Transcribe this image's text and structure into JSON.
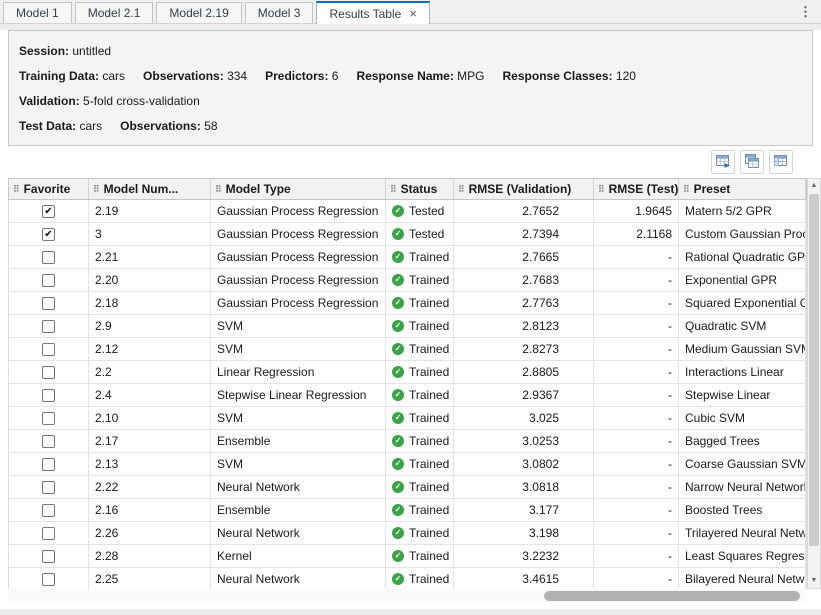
{
  "colors": {
    "accent_blue": "#0072bd",
    "status_green": "#3aa345"
  },
  "icons": {
    "overflow_menu": "⋮",
    "close": "×",
    "grip": "⠿",
    "checkbox_check": "✔",
    "status_check": "✓",
    "scroll_up": "▲",
    "scroll_down": "▼"
  },
  "tab_bar": {
    "tabs": [
      {
        "label": "Model 1",
        "active": false,
        "closable": false
      },
      {
        "label": "Model 2.1",
        "active": false,
        "closable": false
      },
      {
        "label": "Model 2.19",
        "active": false,
        "closable": false
      },
      {
        "label": "Model 3",
        "active": false,
        "closable": false
      },
      {
        "label": "Results Table",
        "active": true,
        "closable": true
      }
    ]
  },
  "session_panel": {
    "lines": [
      {
        "pairs": [
          {
            "label": "Session:",
            "value": "untitled"
          }
        ]
      },
      {
        "pairs": [
          {
            "label": "Training Data:",
            "value": "cars"
          },
          {
            "label": "Observations:",
            "value": "334"
          },
          {
            "label": "Predictors:",
            "value": "6"
          },
          {
            "label": "Response Name:",
            "value": "MPG"
          },
          {
            "label": "Response Classes:",
            "value": "120"
          }
        ]
      },
      {
        "pairs": [
          {
            "label": "Validation:",
            "value": "5-fold cross-validation"
          }
        ]
      },
      {
        "pairs": [
          {
            "label": "Test Data:",
            "value": "cars"
          },
          {
            "label": "Observations:",
            "value": "58"
          }
        ]
      }
    ]
  },
  "toolbar": {
    "buttons": [
      {
        "name": "export-table-button",
        "icon": "export-table-icon"
      },
      {
        "name": "copy-table-button",
        "icon": "copy-table-icon"
      },
      {
        "name": "open-table-button",
        "icon": "open-table-icon"
      }
    ]
  },
  "table": {
    "columns": [
      {
        "key": "favorite",
        "label": "Favorite"
      },
      {
        "key": "model_number",
        "label": "Model Num..."
      },
      {
        "key": "model_type",
        "label": "Model Type"
      },
      {
        "key": "status",
        "label": "Status"
      },
      {
        "key": "rmse_validation",
        "label": "RMSE (Validation)"
      },
      {
        "key": "rmse_test",
        "label": "RMSE (Test)"
      },
      {
        "key": "preset",
        "label": "Preset"
      }
    ],
    "rows": [
      {
        "favorite": true,
        "model_number": "2.19",
        "model_type": "Gaussian Process Regression",
        "status": "Tested",
        "rmse_validation": "2.7652",
        "rmse_test": "1.9645",
        "preset": "Matern 5/2 GPR"
      },
      {
        "favorite": true,
        "model_number": "3",
        "model_type": "Gaussian Process Regression",
        "status": "Tested",
        "rmse_validation": "2.7394",
        "rmse_test": "2.1168",
        "preset": "Custom Gaussian Process"
      },
      {
        "favorite": false,
        "model_number": "2.21",
        "model_type": "Gaussian Process Regression",
        "status": "Trained",
        "rmse_validation": "2.7665",
        "rmse_test": "-",
        "preset": "Rational Quadratic GPR"
      },
      {
        "favorite": false,
        "model_number": "2.20",
        "model_type": "Gaussian Process Regression",
        "status": "Trained",
        "rmse_validation": "2.7683",
        "rmse_test": "-",
        "preset": "Exponential GPR"
      },
      {
        "favorite": false,
        "model_number": "2.18",
        "model_type": "Gaussian Process Regression",
        "status": "Trained",
        "rmse_validation": "2.7763",
        "rmse_test": "-",
        "preset": "Squared Exponential GPR"
      },
      {
        "favorite": false,
        "model_number": "2.9",
        "model_type": "SVM",
        "status": "Trained",
        "rmse_validation": "2.8123",
        "rmse_test": "-",
        "preset": "Quadratic SVM"
      },
      {
        "favorite": false,
        "model_number": "2.12",
        "model_type": "SVM",
        "status": "Trained",
        "rmse_validation": "2.8273",
        "rmse_test": "-",
        "preset": "Medium Gaussian SVM"
      },
      {
        "favorite": false,
        "model_number": "2.2",
        "model_type": "Linear Regression",
        "status": "Trained",
        "rmse_validation": "2.8805",
        "rmse_test": "-",
        "preset": "Interactions Linear"
      },
      {
        "favorite": false,
        "model_number": "2.4",
        "model_type": "Stepwise Linear Regression",
        "status": "Trained",
        "rmse_validation": "2.9367",
        "rmse_test": "-",
        "preset": "Stepwise Linear"
      },
      {
        "favorite": false,
        "model_number": "2.10",
        "model_type": "SVM",
        "status": "Trained",
        "rmse_validation": "3.025",
        "rmse_test": "-",
        "preset": "Cubic SVM"
      },
      {
        "favorite": false,
        "model_number": "2.17",
        "model_type": "Ensemble",
        "status": "Trained",
        "rmse_validation": "3.0253",
        "rmse_test": "-",
        "preset": "Bagged Trees"
      },
      {
        "favorite": false,
        "model_number": "2.13",
        "model_type": "SVM",
        "status": "Trained",
        "rmse_validation": "3.0802",
        "rmse_test": "-",
        "preset": "Coarse Gaussian SVM"
      },
      {
        "favorite": false,
        "model_number": "2.22",
        "model_type": "Neural Network",
        "status": "Trained",
        "rmse_validation": "3.0818",
        "rmse_test": "-",
        "preset": "Narrow Neural Network"
      },
      {
        "favorite": false,
        "model_number": "2.16",
        "model_type": "Ensemble",
        "status": "Trained",
        "rmse_validation": "3.177",
        "rmse_test": "-",
        "preset": "Boosted Trees"
      },
      {
        "favorite": false,
        "model_number": "2.26",
        "model_type": "Neural Network",
        "status": "Trained",
        "rmse_validation": "3.198",
        "rmse_test": "-",
        "preset": "Trilayered Neural Network"
      },
      {
        "favorite": false,
        "model_number": "2.28",
        "model_type": "Kernel",
        "status": "Trained",
        "rmse_validation": "3.2232",
        "rmse_test": "-",
        "preset": "Least Squares Regression Kernel"
      },
      {
        "favorite": false,
        "model_number": "2.25",
        "model_type": "Neural Network",
        "status": "Trained",
        "rmse_validation": "3.4615",
        "rmse_test": "-",
        "preset": "Bilayered Neural Network"
      }
    ]
  }
}
